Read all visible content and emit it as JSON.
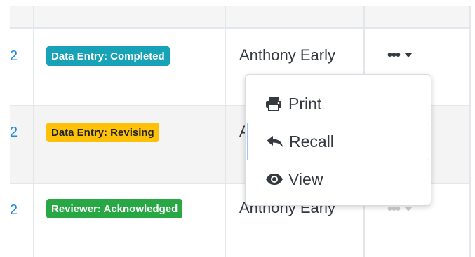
{
  "rows": [
    {
      "id_fragment": "2",
      "status": "Data Entry: Completed",
      "status_color": "#17a2b8",
      "assignee": "Anthony Early",
      "actions": "•••"
    },
    {
      "id_fragment": "2",
      "status": "Data Entry: Revising",
      "status_color": "#ffc107",
      "assignee": "A",
      "actions": "•••"
    },
    {
      "id_fragment": "2",
      "status": "Reviewer: Acknowledged",
      "status_color": "#28a745",
      "assignee": "Anthony Early",
      "actions": "•••"
    }
  ],
  "dropdown_menu": {
    "items": [
      {
        "label": "Print",
        "icon": "printer-icon"
      },
      {
        "label": "Recall",
        "icon": "reply-icon",
        "highlighted": true
      },
      {
        "label": "View",
        "icon": "eye-icon"
      }
    ]
  },
  "colors": {
    "link": "#1e88e5",
    "grid": "#e3e6ea",
    "menu_focus": "#9ec5fe"
  }
}
